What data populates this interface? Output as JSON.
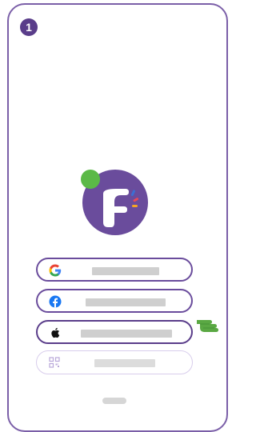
{
  "step": {
    "number": "1"
  },
  "logo": {
    "icon": "brand-logo-icon"
  },
  "login_options": [
    {
      "provider": "google",
      "icon": "google-icon",
      "label": "",
      "state": "enabled"
    },
    {
      "provider": "facebook",
      "icon": "facebook-icon",
      "label": "",
      "state": "enabled"
    },
    {
      "provider": "apple",
      "icon": "apple-icon",
      "label": "",
      "state": "selected"
    },
    {
      "provider": "qr-code",
      "icon": "qr-code-icon",
      "label": "",
      "state": "disabled"
    }
  ],
  "pointer": {
    "icon": "pointing-hand-icon"
  },
  "colors": {
    "primary_purple": "#6a4c9c",
    "frame_purple": "#7b5fa8",
    "badge_purple": "#5a3d8a",
    "logo_green": "#5bb947",
    "hand_green": "#5aa843",
    "disabled_border": "#d8cdec",
    "placeholder_gray": "#cfcfcf"
  }
}
